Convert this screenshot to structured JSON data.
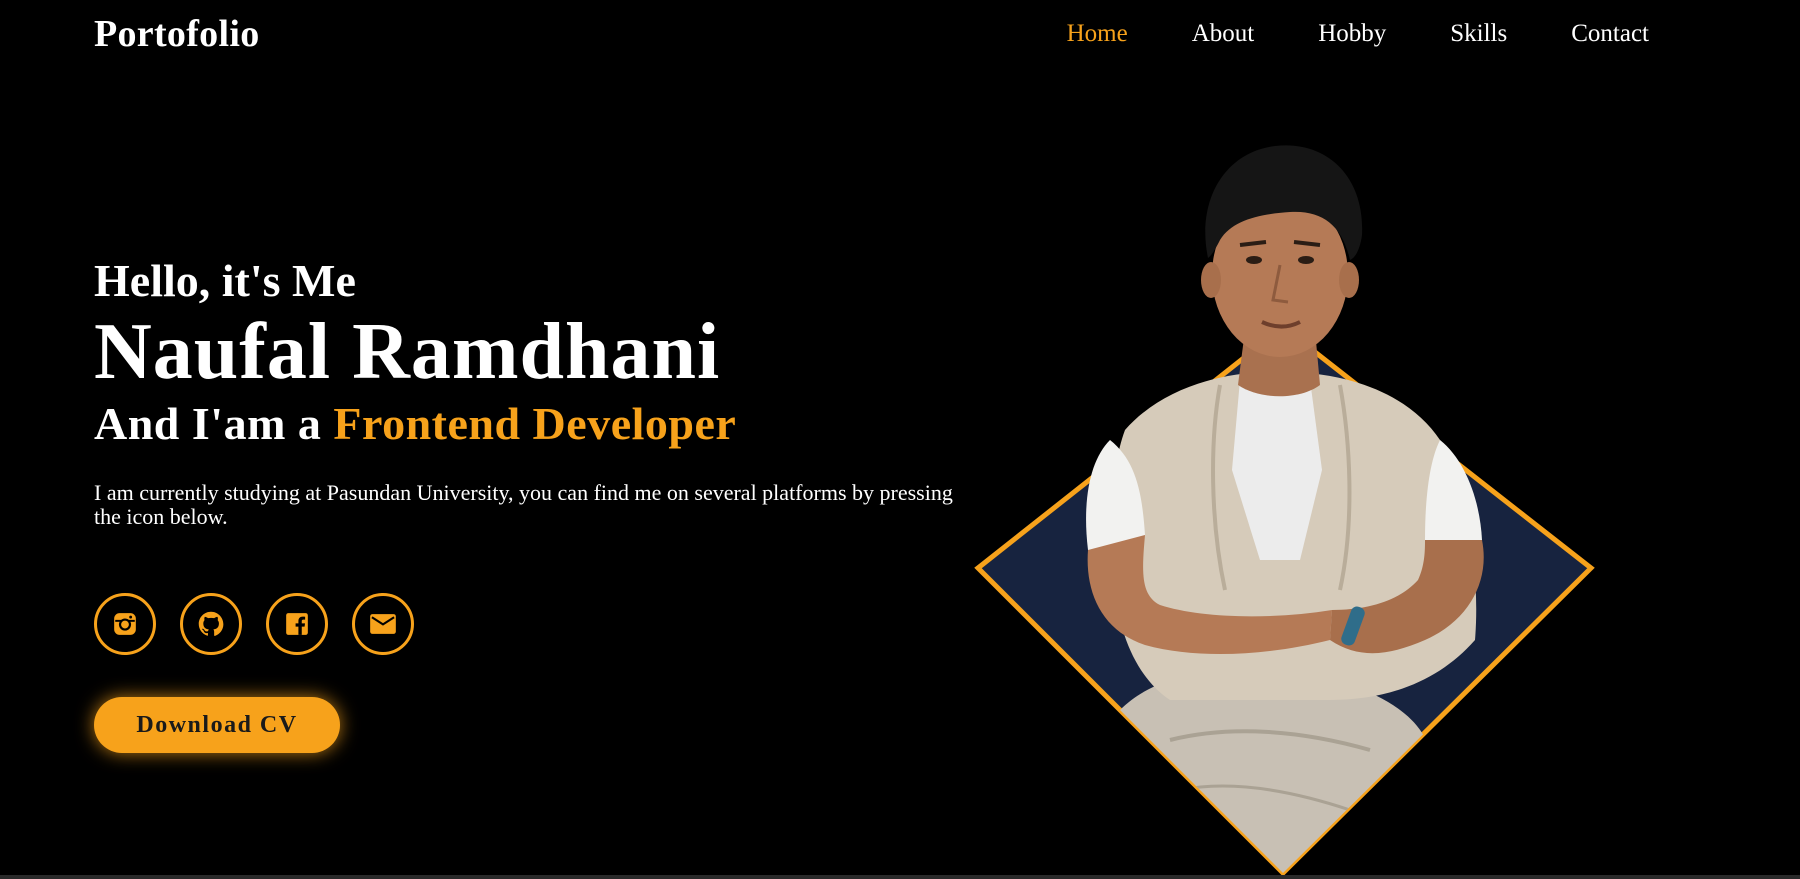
{
  "header": {
    "logo": "Portofolio",
    "nav": [
      {
        "label": "Home",
        "active": true
      },
      {
        "label": "About",
        "active": false
      },
      {
        "label": "Hobby",
        "active": false
      },
      {
        "label": "Skills",
        "active": false
      },
      {
        "label": "Contact",
        "active": false
      }
    ]
  },
  "hero": {
    "greeting": "Hello, it's Me",
    "name": "Naufal Ramdhani",
    "role_prefix": "And I'am a",
    "role_highlight": "Frontend Developer",
    "intro": "I am currently studying at Pasundan University, you can find me on several platforms by pressing the icon below."
  },
  "socials": [
    {
      "icon": "instagram-icon"
    },
    {
      "icon": "github-icon"
    },
    {
      "icon": "facebook-icon"
    },
    {
      "icon": "mail-icon"
    }
  ],
  "cta": {
    "download_label": "Download CV"
  },
  "colors": {
    "accent": "#f7a21b",
    "background": "#000000",
    "text": "#ffffff",
    "portrait_backdrop": "#17233f"
  }
}
